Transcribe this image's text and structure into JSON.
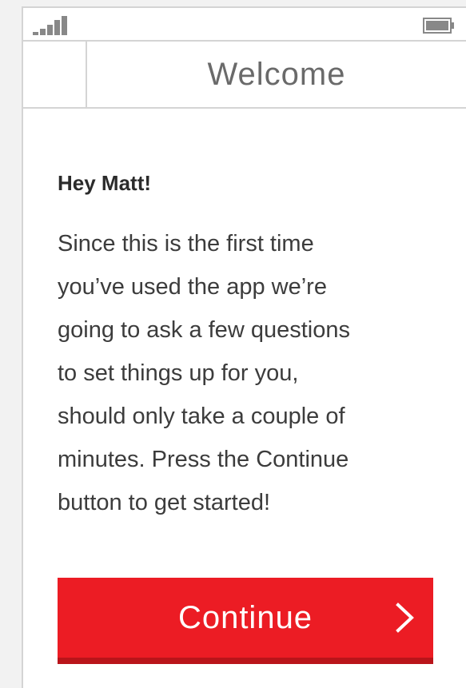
{
  "status_bar": {
    "signal_icon": "signal-strength-icon",
    "battery_icon": "battery-icon"
  },
  "nav": {
    "title": "Welcome"
  },
  "content": {
    "greeting": "Hey Matt!",
    "intro_lines": [
      "Since this is the first time",
      "you’ve used the app we’re",
      "going to ask a few questions",
      "to set things up for you,",
      "should only take a couple of",
      "minutes. Press the Continue",
      "button to get started!"
    ]
  },
  "continue_button": {
    "label": "Continue",
    "icon": "chevron-right-icon",
    "color": "#ec1c24"
  }
}
